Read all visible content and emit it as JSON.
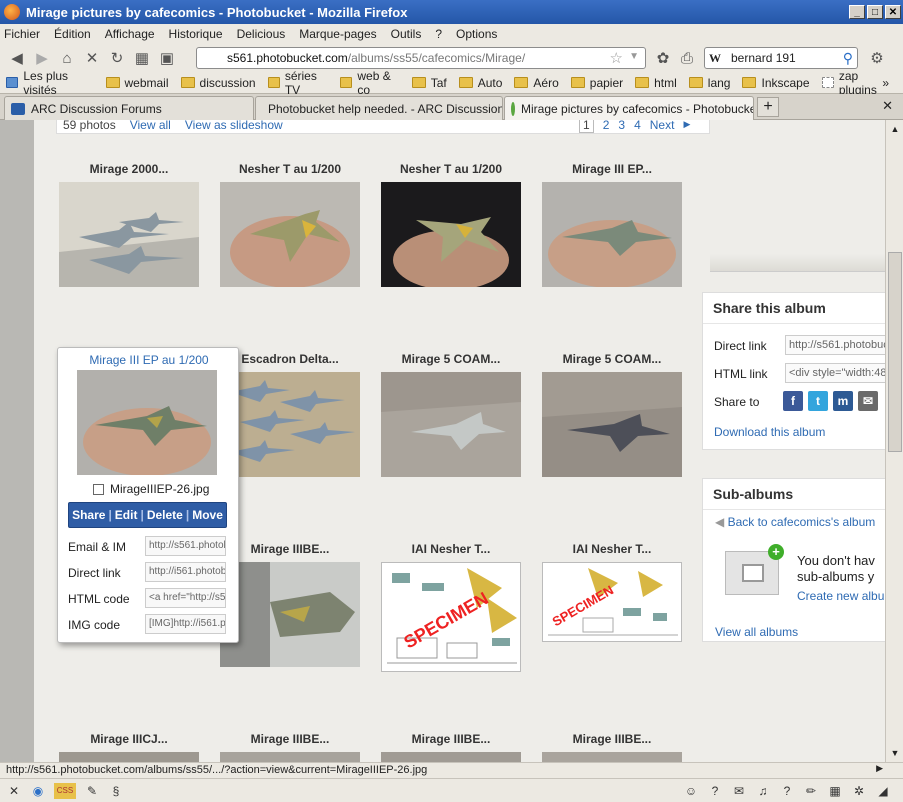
{
  "window": {
    "title": "Mirage pictures by cafecomics - Photobucket - Mozilla Firefox"
  },
  "menu": [
    "Fichier",
    "Édition",
    "Affichage",
    "Historique",
    "Delicious",
    "Marque-pages",
    "Outils",
    "?",
    "Options"
  ],
  "url": {
    "domain": "s561.photobucket.com",
    "path": "/albums/ss55/cafecomics/Mirage/"
  },
  "search": {
    "engine": "W",
    "value": "bernard 191"
  },
  "bookmarks": [
    "Les plus visités",
    "webmail",
    "discussion",
    "séries TV",
    "web & co",
    "Taf",
    "Auto",
    "Aéro",
    "papier",
    "html",
    "lang",
    "Inkscape",
    "zap plugins"
  ],
  "tabs": [
    {
      "label": "ARC Discussion Forums"
    },
    {
      "label": "Photobucket help needed. - ARC Discussion ..."
    },
    {
      "label": "Mirage pictures by cafecomics - Photobucket"
    }
  ],
  "pager": {
    "count": "59 photos",
    "view_all": "View all",
    "slideshow": "View as slideshow",
    "pages": [
      "1",
      "2",
      "3",
      "4"
    ],
    "next": "Next"
  },
  "photos": [
    {
      "title": "Mirage 2000..."
    },
    {
      "title": "Nesher T au 1/200"
    },
    {
      "title": "Nesher T au 1/200"
    },
    {
      "title": "Mirage III EP..."
    },
    {
      "title": "Escadron Delta..."
    },
    {
      "title": "Mirage 5 COAM..."
    },
    {
      "title": "Mirage 5 COAM..."
    },
    {
      "title": "Mirage IIIBE..."
    },
    {
      "title": "IAI Nesher T..."
    },
    {
      "title": "IAI Nesher T..."
    },
    {
      "title": "Mirage IIICJ..."
    },
    {
      "title": "Mirage IIIBE..."
    },
    {
      "title": "Mirage IIIBE..."
    },
    {
      "title": "Mirage IIIBE..."
    }
  ],
  "specimen": "SPECIMEN",
  "popup": {
    "title": "Mirage III EP au 1/200",
    "filename": "MirageIIIEP-26.jpg",
    "actions": [
      "Share",
      "Edit",
      "Delete",
      "Move"
    ],
    "rows": [
      {
        "label": "Email & IM",
        "value": "http://s561.photob"
      },
      {
        "label": "Direct link",
        "value": "http://i561.photob"
      },
      {
        "label": "HTML code",
        "value": "<a href=\"http://s5"
      },
      {
        "label": "IMG code",
        "value": "[IMG]http://i561.p"
      }
    ]
  },
  "share": {
    "title": "Share this album",
    "direct_label": "Direct link",
    "direct_value": "http://s561.photobuc",
    "html_label": "HTML link",
    "html_value": "<div style=\"width:48",
    "share_to": "Share to",
    "download": "Download this album"
  },
  "subalbums": {
    "title": "Sub-albums",
    "back": "Back to cafecomics's album",
    "empty1": "You don't hav",
    "empty2": "sub-albums y",
    "create": "Create new albu",
    "view_all": "View all albums"
  },
  "status": "http://s561.photobucket.com/albums/ss55/.../?action=view&current=MirageIIIEP-26.jpg"
}
